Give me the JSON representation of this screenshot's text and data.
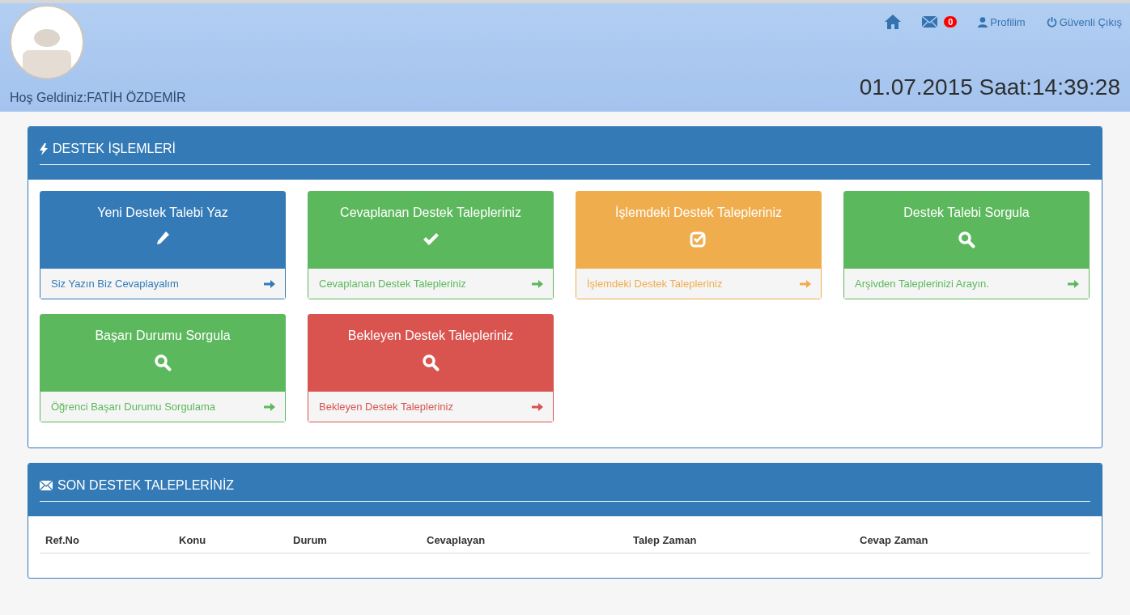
{
  "header": {
    "welcome": "Hoş Geldiniz:FATİH ÖZDEMİR",
    "datetime": "01.07.2015 Saat:14:39:28",
    "mail_count": "0",
    "profile_link": "Profilim",
    "logout_link": "Güvenli Çıkış"
  },
  "support_panel": {
    "title": "DESTEK İŞLEMLERİ",
    "cards": [
      {
        "title": "Yeni Destek Talebi Yaz",
        "kind": "pencil",
        "color": "#337ab7",
        "footer": "Siz Yazın Biz Cevaplayalım"
      },
      {
        "title": "Cevaplanan Destek Talepleriniz",
        "kind": "check",
        "color": "#5cb85c",
        "footer": "Cevaplanan Destek Talepleriniz"
      },
      {
        "title": "İşlemdeki Destek Talepleriniz",
        "kind": "checkbox",
        "color": "#f0ad4e",
        "footer": "İşlemdeki Destek Talepleriniz"
      },
      {
        "title": "Destek Talebi Sorgula",
        "kind": "search",
        "color": "#5cb85c",
        "footer": "Arşivden Taleplerinizi Arayın."
      },
      {
        "title": "Başarı Durumu Sorgula",
        "kind": "search",
        "color": "#5cb85c",
        "footer": "Öğrenci Başarı Durumu Sorgulama"
      },
      {
        "title": "Bekleyen Destek Talepleriniz",
        "kind": "search",
        "color": "#d9534f",
        "footer": "Bekleyen Destek Talepleriniz"
      }
    ]
  },
  "recent_panel": {
    "title": "SON DESTEK TALEPLERİNİZ",
    "table": {
      "columns": [
        "Ref.No",
        "Konu",
        "Durum",
        "Cevaplayan",
        "Talep Zaman",
        "Cevap Zaman"
      ]
    }
  }
}
